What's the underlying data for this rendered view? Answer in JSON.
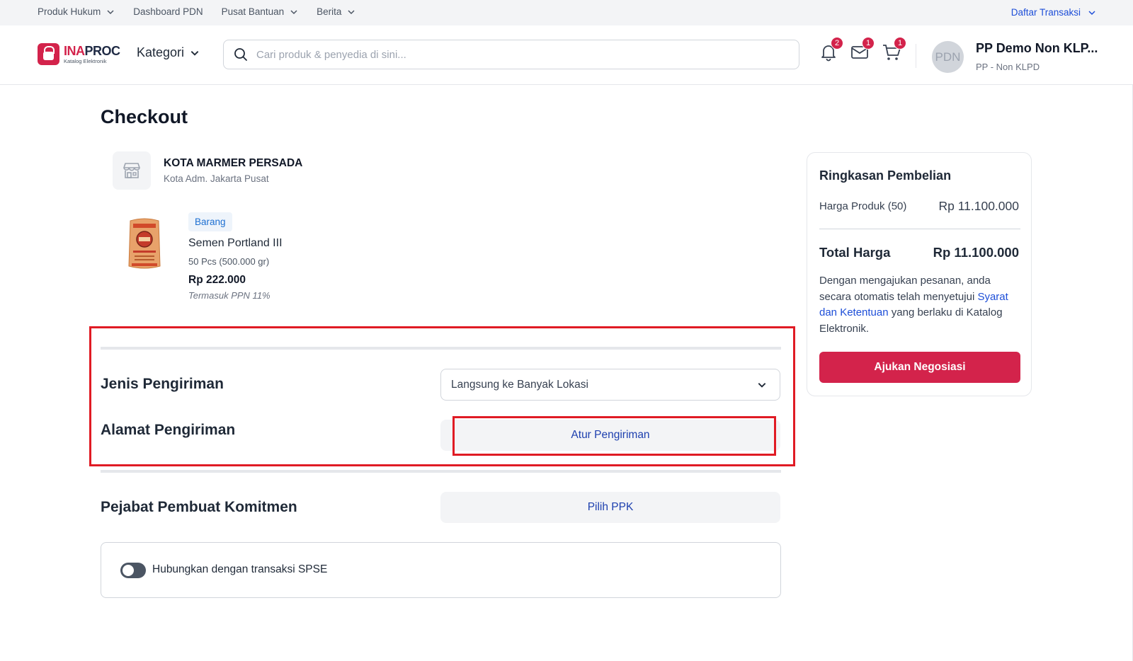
{
  "utilbar": {
    "items": [
      {
        "label": "Produk Hukum",
        "has_dropdown": true
      },
      {
        "label": "Dashboard PDN",
        "has_dropdown": false
      },
      {
        "label": "Pusat Bantuan",
        "has_dropdown": true
      },
      {
        "label": "Berita",
        "has_dropdown": true
      }
    ],
    "right_label": "Daftar Transaksi"
  },
  "header": {
    "logo_main_a": "INA",
    "logo_main_b": "PROC",
    "logo_sub": "Katalog Elektronik",
    "kategori_label": "Kategori",
    "search_placeholder": "Cari produk & penyedia di sini...",
    "notifications_count": "2",
    "messages_count": "1",
    "cart_count": "1",
    "avatar_text": "PDN",
    "user_name": "PP Demo Non KLP...",
    "user_role": "PP - Non KLPD"
  },
  "checkout": {
    "title": "Checkout",
    "shop_name": "KOTA MARMER PERSADA",
    "shop_location": "Kota Adm. Jakarta Pusat",
    "product": {
      "tag": "Barang",
      "name": "Semen Portland III",
      "quantity": "50 Pcs (500.000 gr)",
      "price": "Rp 222.000",
      "tax_note": "Termasuk PPN 11%"
    },
    "shipping_type_label": "Jenis Pengiriman",
    "shipping_type_value": "Langsung ke Banyak Lokasi",
    "shipping_address_label": "Alamat Pengiriman",
    "shipping_address_button": "Atur Pengiriman",
    "ppk_label": "Pejabat Pembuat Komitmen",
    "ppk_button": "Pilih PPK",
    "spse_toggle_label": "Hubungkan dengan transaksi SPSE"
  },
  "summary": {
    "title": "Ringkasan Pembelian",
    "product_price_label": "Harga Produk (50)",
    "product_price_value": "Rp 11.100.000",
    "total_label": "Total Harga",
    "total_value": "Rp 11.100.000",
    "note_before": "Dengan mengajukan pesanan, anda secara otomatis telah menyetujui ",
    "note_link": "Syarat dan Ketentuan",
    "note_after": " yang berlaku di Katalog Elektronik.",
    "submit_button": "Ajukan Negosiasi"
  },
  "colors": {
    "brand": "#d3234b",
    "link": "#1d4ed8",
    "highlight_box": "#e01b24"
  }
}
